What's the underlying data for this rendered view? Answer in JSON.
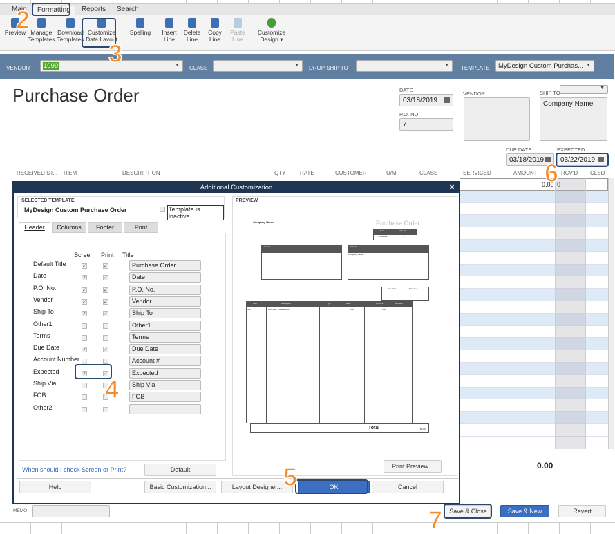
{
  "ribbon": {
    "tabs": [
      "Main",
      "Formatting",
      "Reports",
      "Search"
    ],
    "active_tab": "Formatting",
    "buttons": [
      {
        "label": "Preview",
        "icon": "preview-icon"
      },
      {
        "label": "Manage Templates",
        "icon": "template-icon"
      },
      {
        "label": "Download Templates",
        "icon": "download-icon"
      },
      {
        "label": "Customize Data Layout",
        "icon": "customize-icon"
      },
      {
        "label": "Spelling",
        "icon": "spelling-icon"
      },
      {
        "label": "Insert Line",
        "icon": "insert-line-icon"
      },
      {
        "label": "Delete Line",
        "icon": "delete-line-icon"
      },
      {
        "label": "Copy Line",
        "icon": "copy-icon"
      },
      {
        "label": "Paste Line",
        "icon": "paste-icon",
        "disabled": true
      },
      {
        "label": "Customize Design ▾",
        "icon": "palette-icon"
      }
    ]
  },
  "bar": {
    "vendor_label": "VENDOR",
    "vendor_value": "1099",
    "class_label": "CLASS",
    "class_value": "",
    "drop_ship_label": "DROP SHIP TO",
    "drop_ship_value": "",
    "template_label": "TEMPLATE",
    "template_value": "MyDesign Custom Purchas..."
  },
  "form": {
    "title": "Purchase Order",
    "date_label": "DATE",
    "date": "03/18/2019",
    "po_label": "P.O. NO.",
    "po": "7",
    "vendor_label": "VENDOR",
    "ship_to_label": "SHIP TO",
    "ship_to": "Company Name",
    "due_date_label": "DUE DATE",
    "due_date": "03/18/2019",
    "expected_label": "EXPECTED",
    "expected": "03/22/2019"
  },
  "columns": [
    "RECEIVED ST...",
    "ITEM",
    "DESCRIPTION",
    "QTY",
    "RATE",
    "CUSTOMER",
    "U/M",
    "CLASS",
    "SERVICED",
    "AMOUNT",
    "RCV'D",
    "CLSD"
  ],
  "first_row_amount": "0.00",
  "first_row_rcvd": "0",
  "total": "0.00",
  "memo_label": "MEMO",
  "footer": {
    "save_close": "Save & Close",
    "save_new": "Save & New",
    "revert": "Revert"
  },
  "dialog": {
    "title": "Additional Customization",
    "selected_template_label": "SELECTED TEMPLATE",
    "template_name": "MyDesign Custom Purchase Order",
    "inactive_label": "Template is inactive",
    "tabs": [
      "Header",
      "Columns",
      "Footer",
      "Print"
    ],
    "active_tab": "Header",
    "col_screen": "Screen",
    "col_print": "Print",
    "col_title": "Title",
    "rows": [
      {
        "label": "Default Title",
        "screen": true,
        "print": true,
        "title": "Purchase Order"
      },
      {
        "label": "Date",
        "screen": true,
        "print": true,
        "title": "Date"
      },
      {
        "label": "P.O. No.",
        "screen": true,
        "print": true,
        "title": "P.O. No."
      },
      {
        "label": "Vendor",
        "screen": true,
        "print": true,
        "title": "Vendor"
      },
      {
        "label": "Ship To",
        "screen": true,
        "print": true,
        "title": "Ship To"
      },
      {
        "label": "Other1",
        "screen": false,
        "print": false,
        "title": "Other1"
      },
      {
        "label": "Terms",
        "screen": false,
        "print": false,
        "title": "Terms"
      },
      {
        "label": "Due Date",
        "screen": true,
        "print": true,
        "title": "Due Date"
      },
      {
        "label": "Account Number",
        "screen": false,
        "print": false,
        "title": "Account #"
      },
      {
        "label": "Expected",
        "screen": true,
        "print": true,
        "title": "Expected"
      },
      {
        "label": "Ship Via",
        "screen": false,
        "print": false,
        "title": "Ship Via"
      },
      {
        "label": "FOB",
        "screen": false,
        "print": false,
        "title": "FOB"
      },
      {
        "label": "Other2",
        "screen": false,
        "print": false,
        "title": ""
      }
    ],
    "help_link": "When should I check Screen or Print?",
    "default_btn": "Default",
    "preview_label": "PREVIEW",
    "print_preview_btn": "Print Preview...",
    "help_btn": "Help",
    "basic_btn": "Basic Customization...",
    "layout_btn": "Layout Designer...",
    "ok_btn": "OK",
    "cancel_btn": "Cancel",
    "preview": {
      "company": "Company Name",
      "title": "Purchase Order",
      "date_h": "Date",
      "po_h": "P.O. No.",
      "date": "3/18/2019",
      "po": "7",
      "vendor_h": "Vendor",
      "ship_h": "Ship To",
      "ship": "Company name",
      "due_h": "Due Date",
      "exp_h": "Expected",
      "cols": [
        "Item",
        "Description",
        "Qty",
        "Rate",
        "Amount",
        "Serviced"
      ],
      "item": "fuel",
      "desc": "Purchase Transactions",
      "rate": "0.00",
      "amount": "0.00",
      "total_label": "Total",
      "total": "$0.00"
    }
  },
  "annotations": [
    "2",
    "3",
    "4",
    "5",
    "6",
    "7"
  ],
  "colors": {
    "bar": "#617fa1",
    "dialog_title": "#1f3653",
    "accent_orange": "#f58b2a",
    "ok_blue": "#3c6fc2"
  }
}
